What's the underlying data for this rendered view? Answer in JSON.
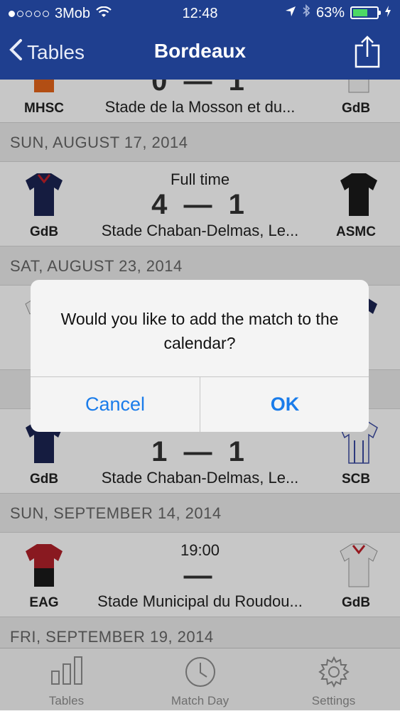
{
  "status_bar": {
    "carrier": "3Mob",
    "time": "12:48",
    "battery": "63%",
    "battery_level": 0.63
  },
  "nav": {
    "back_label": "Tables",
    "title": "Bordeaux"
  },
  "matches": [
    {
      "home": "MHSC",
      "away": "GdB",
      "score": "0 — 1",
      "venue": "Stade de la Mosson et du..."
    },
    {
      "date": "SUN, AUGUST 17, 2014",
      "status": "Full time",
      "score": "4 — 1",
      "home": "GdB",
      "away": "ASMC",
      "venue": "Stade Chaban-Delmas, Le..."
    },
    {
      "date": "SAT, AUGUST 23, 2014"
    },
    {
      "score": "1 — 1",
      "home": "GdB",
      "away": "SCB",
      "venue": "Stade Chaban-Delmas, Le..."
    },
    {
      "date": "SUN, SEPTEMBER 14, 2014",
      "status": "19:00",
      "score": "—",
      "home": "EAG",
      "away": "GdB",
      "venue": "Stade Municipal du Roudou..."
    },
    {
      "date": "FRI, SEPTEMBER 19, 2014"
    }
  ],
  "alert": {
    "message": "Would you like to add the match to the calendar?",
    "cancel": "Cancel",
    "ok": "OK"
  },
  "tabs": [
    {
      "label": "Tables",
      "icon": "bar-chart-icon"
    },
    {
      "label": "Match Day",
      "icon": "clock-icon"
    },
    {
      "label": "Settings",
      "icon": "gear-icon"
    }
  ],
  "colors": {
    "nav_bg": "#1f3f8f",
    "accent": "#1a7cea",
    "gdb_jersey": "#1c2452",
    "asmc_jersey": "#1a1a1a",
    "eag_jersey": "#b0202a"
  }
}
